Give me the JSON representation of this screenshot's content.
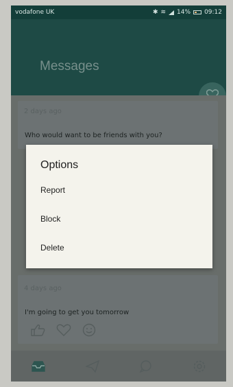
{
  "status_bar": {
    "carrier": "vodafone UK",
    "battery": "14%",
    "time": "09:12"
  },
  "header": {
    "title": "Messages"
  },
  "messages": [
    {
      "meta": "2 days ago",
      "text": "Who would want to be friends with you?"
    },
    {
      "meta": "4 days ago",
      "text": "I'm going to get you tomorrow"
    }
  ],
  "dialog": {
    "title": "Options",
    "options": [
      "Report",
      "Block",
      "Delete"
    ]
  },
  "icons": {
    "fab": "heart-icon",
    "actions": [
      "like-icon",
      "heart-icon",
      "smile-icon"
    ],
    "nav": [
      "inbox-icon",
      "send-icon",
      "chat-icon",
      "settings-icon"
    ]
  },
  "colors": {
    "header": "#1f4e48",
    "status_bar": "#133e39",
    "dialog_bg": "#f4f3ec",
    "screen_dimmed": "#6f7470"
  }
}
